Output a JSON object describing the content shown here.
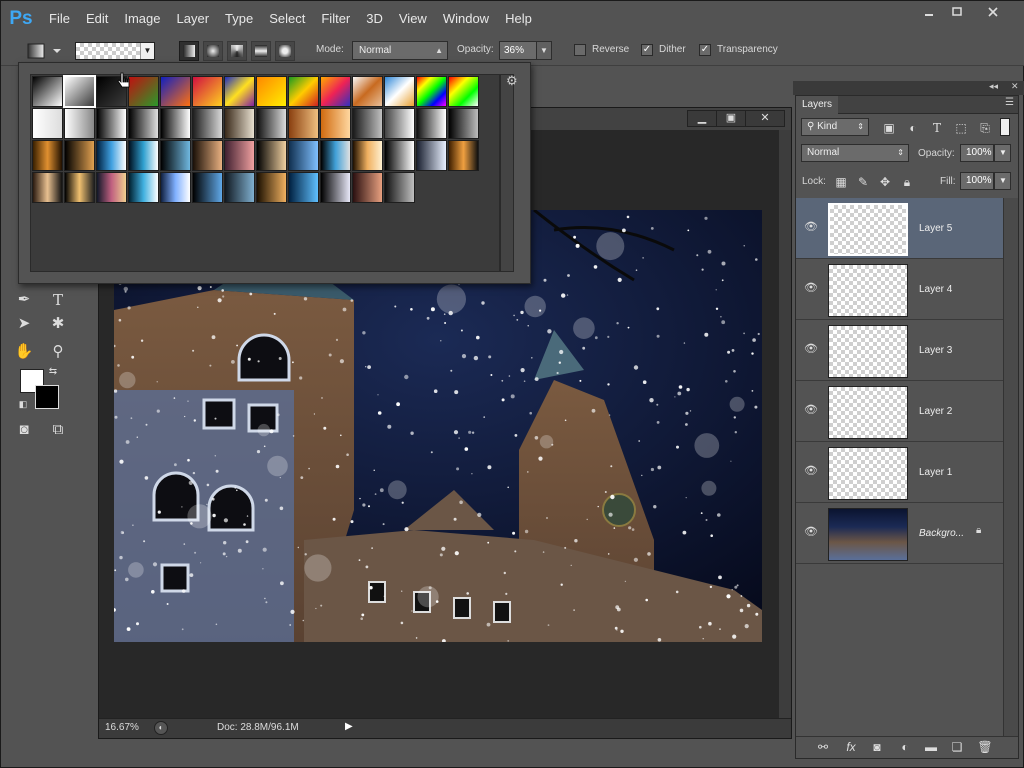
{
  "app": {
    "logo": "Ps"
  },
  "menu": [
    "File",
    "Edit",
    "Image",
    "Layer",
    "Type",
    "Select",
    "Filter",
    "3D",
    "View",
    "Window",
    "Help"
  ],
  "options": {
    "mode_label": "Mode:",
    "mode_value": "Normal",
    "opacity_label": "Opacity:",
    "opacity_value": "36%",
    "reverse_label": "Reverse",
    "dither_label": "Dither",
    "transparency_label": "Transparency",
    "reverse_checked": false,
    "dither_checked": true,
    "transparency_checked": true
  },
  "gradient_picker": {
    "rows": 4,
    "presets_per_row": 14,
    "selected_index": 1,
    "colors": [
      [
        "#000000",
        "#ffffff"
      ],
      [
        "#ffffff",
        "rgba(255,255,255,0)"
      ],
      [
        "#000000",
        "rgba(0,0,0,0)"
      ],
      [
        "#c01010",
        "#2a9a2a"
      ],
      [
        "#1020c0",
        "#ff7010"
      ],
      [
        "#d01040",
        "#ffd020"
      ],
      [
        "#2030c0",
        "#ffe020",
        "#8020a0"
      ],
      [
        "#ff8800",
        "#ffee00"
      ],
      [
        "#1a9a20",
        "#ffcc00",
        "#d02020"
      ],
      [
        "#ffaa00",
        "#ee2255",
        "#3030c0"
      ],
      [
        "#f8f8f8",
        "#c86a20",
        "#e8c09a"
      ],
      [
        "#3088d8",
        "#ffffff",
        "#e8a030"
      ],
      [
        "#ff0000",
        "#ffff00",
        "#00ff00",
        "#0000ff",
        "#ff00ff"
      ],
      [
        "#ff0000",
        "#ffff00",
        "#00ff00",
        "#ffffff"
      ],
      [
        "#ffffff",
        "#dddddd"
      ],
      [
        "#ffffff",
        "#888888"
      ],
      [
        "#000000",
        "#ffffff"
      ],
      [
        "#000000",
        "#e0e0e0"
      ],
      [
        "#000000",
        "#ffffff"
      ],
      [
        "#1e1e1e",
        "#d8d8d8"
      ],
      [
        "#3a2a1a",
        "#e8e0d0"
      ],
      [
        "#101010",
        "#dcdcdc"
      ],
      [
        "#8a4010",
        "#f0c080"
      ],
      [
        "#d06a10",
        "#ffd8a0"
      ],
      [
        "#1a1a1a",
        "#c0c0c0"
      ],
      [
        "#444444",
        "#ffffff"
      ],
      [
        "#101010",
        "#ffffff"
      ],
      [
        "#000000",
        "#bdbdbd"
      ],
      [
        "#3a2000",
        "#e09030",
        "#201000"
      ],
      [
        "#000000",
        "#e0a050"
      ],
      [
        "#002040",
        "#40a0e0",
        "#ffffff"
      ],
      [
        "#001020",
        "#30a0d0",
        "#ffffff"
      ],
      [
        "#000000",
        "#70b8e0"
      ],
      [
        "#1a1008",
        "#e8b080"
      ],
      [
        "#402030",
        "#f0a0a0"
      ],
      [
        "#000000",
        "#f0d0a0"
      ],
      [
        "#103050",
        "#80c0ff"
      ],
      [
        "#000000",
        "#40a0d8",
        "#e0e0e0"
      ],
      [
        "#201000",
        "#f0b060",
        "#fff0d0"
      ],
      [
        "#000000",
        "#ffffff"
      ],
      [
        "#1a2030",
        "#e8f0ff"
      ],
      [
        "#402000",
        "#f0a040",
        "#101010"
      ],
      [
        "#2a1a10",
        "#e8c090",
        "#101010"
      ],
      [
        "#000000",
        "#f0c070",
        "#202020"
      ],
      [
        "#101828",
        "#c06080",
        "#f0d090"
      ],
      [
        "#002030",
        "#40b0e0",
        "#ffffff"
      ],
      [
        "#102040",
        "#80b0ff",
        "#ffffff"
      ],
      [
        "#000000",
        "#60a8e8"
      ],
      [
        "#101820",
        "#80b0d0"
      ],
      [
        "#1a0f00",
        "#f0b060"
      ],
      [
        "#002040",
        "#60c0ff"
      ],
      [
        "#000000",
        "#e8e8f8"
      ],
      [
        "#2a1010",
        "#e8a080"
      ],
      [
        "#101010",
        "#c0c0c0"
      ]
    ]
  },
  "document": {
    "zoom": "16.67%",
    "doc_info": "Doc: 28.8M/96.1M"
  },
  "layers_panel": {
    "tab": "Layers",
    "filter_kind": "Kind",
    "blend_mode": "Normal",
    "opacity_label": "Opacity:",
    "opacity_value": "100%",
    "lock_label": "Lock:",
    "fill_label": "Fill:",
    "fill_value": "100%",
    "layers": [
      {
        "name": "Layer 5",
        "selected": true
      },
      {
        "name": "Layer 4",
        "selected": false
      },
      {
        "name": "Layer 3",
        "selected": false
      },
      {
        "name": "Layer 2",
        "selected": false
      },
      {
        "name": "Layer 1",
        "selected": false
      },
      {
        "name": "Backgro...",
        "selected": false
      }
    ]
  }
}
